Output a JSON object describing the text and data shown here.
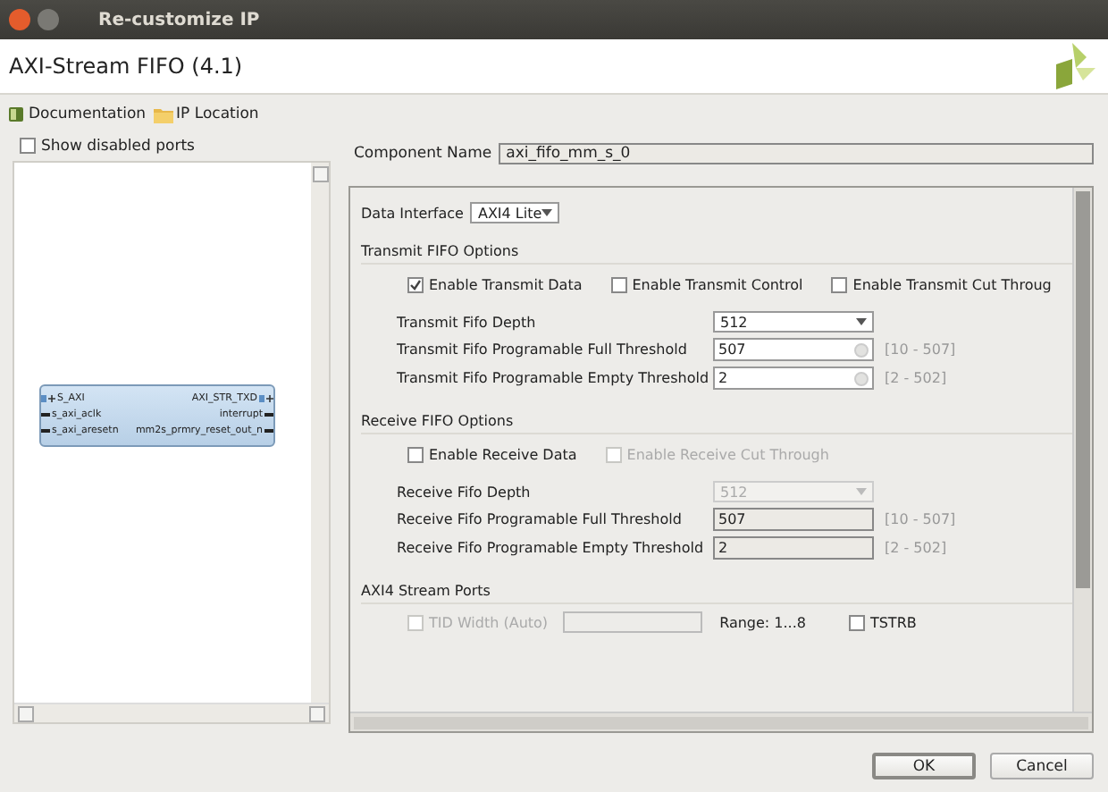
{
  "window": {
    "title": "Re-customize IP"
  },
  "header": {
    "title": "AXI-Stream FIFO (4.1)"
  },
  "toolbar": [
    {
      "label": "Documentation",
      "kind": "book"
    },
    {
      "label": "IP Location",
      "kind": "folder"
    }
  ],
  "ports_panel": {
    "show_disabled": {
      "label": "Show disabled ports",
      "checked": false
    },
    "block": {
      "rows": [
        {
          "left": {
            "label": "S_AXI",
            "kind": "bus"
          },
          "right": {
            "label": "AXI_STR_TXD",
            "kind": "bus"
          }
        },
        {
          "left": {
            "label": "s_axi_aclk",
            "kind": "wire"
          },
          "right": {
            "label": "interrupt",
            "kind": "wire"
          }
        },
        {
          "left": {
            "label": "s_axi_aresetn",
            "kind": "wire"
          },
          "right": {
            "label": "mm2s_prmry_reset_out_n",
            "kind": "wire"
          }
        }
      ]
    }
  },
  "component_name": {
    "label": "Component Name",
    "value": "axi_fifo_mm_s_0"
  },
  "data_interface": {
    "label": "Data Interface",
    "value": "AXI4 Lite"
  },
  "sections": [
    {
      "title": "Transmit FIFO Options",
      "checkboxes": [
        {
          "label": "Enable Transmit Data",
          "checked": true,
          "disabled": false
        },
        {
          "label": "Enable Transmit Control",
          "checked": false,
          "disabled": false
        },
        {
          "label": "Enable Transmit Cut Throug",
          "checked": false,
          "disabled": false
        }
      ],
      "fields": [
        {
          "label": "Transmit Fifo Depth",
          "kind": "dropdown",
          "value": "512"
        },
        {
          "label": "Transmit Fifo Programable Full Threshold",
          "kind": "text",
          "value": "507",
          "range": "[10 - 507]"
        },
        {
          "label": "Transmit Fifo Programable Empty Threshold",
          "kind": "text",
          "value": "2",
          "range": "[2 - 502]"
        }
      ]
    },
    {
      "title": "Receive FIFO Options",
      "checkboxes": [
        {
          "label": "Enable Receive Data",
          "checked": false,
          "disabled": false
        },
        {
          "label": "Enable Receive Cut Through",
          "checked": false,
          "disabled": true
        }
      ],
      "fields": [
        {
          "label": "Receive Fifo Depth",
          "kind": "dropdown",
          "value": "512",
          "disabled": true
        },
        {
          "label": "Receive Fifo Programable Full Threshold",
          "kind": "readonly",
          "value": "507",
          "range": "[10 - 507]"
        },
        {
          "label": "Receive Fifo Programable Empty Threshold",
          "kind": "readonly",
          "value": "2",
          "range": "[2 - 502]"
        }
      ]
    }
  ],
  "stream_ports": {
    "title": "AXI4 Stream Ports",
    "rows": [
      {
        "label": "TID Width (Auto)",
        "checked": false,
        "disabled": true,
        "range": "Range: 1...8",
        "option": {
          "label": "TSTRB",
          "checked": false
        }
      }
    ]
  },
  "buttons": [
    {
      "label": "OK",
      "default": true
    },
    {
      "label": "Cancel",
      "default": false
    }
  ]
}
